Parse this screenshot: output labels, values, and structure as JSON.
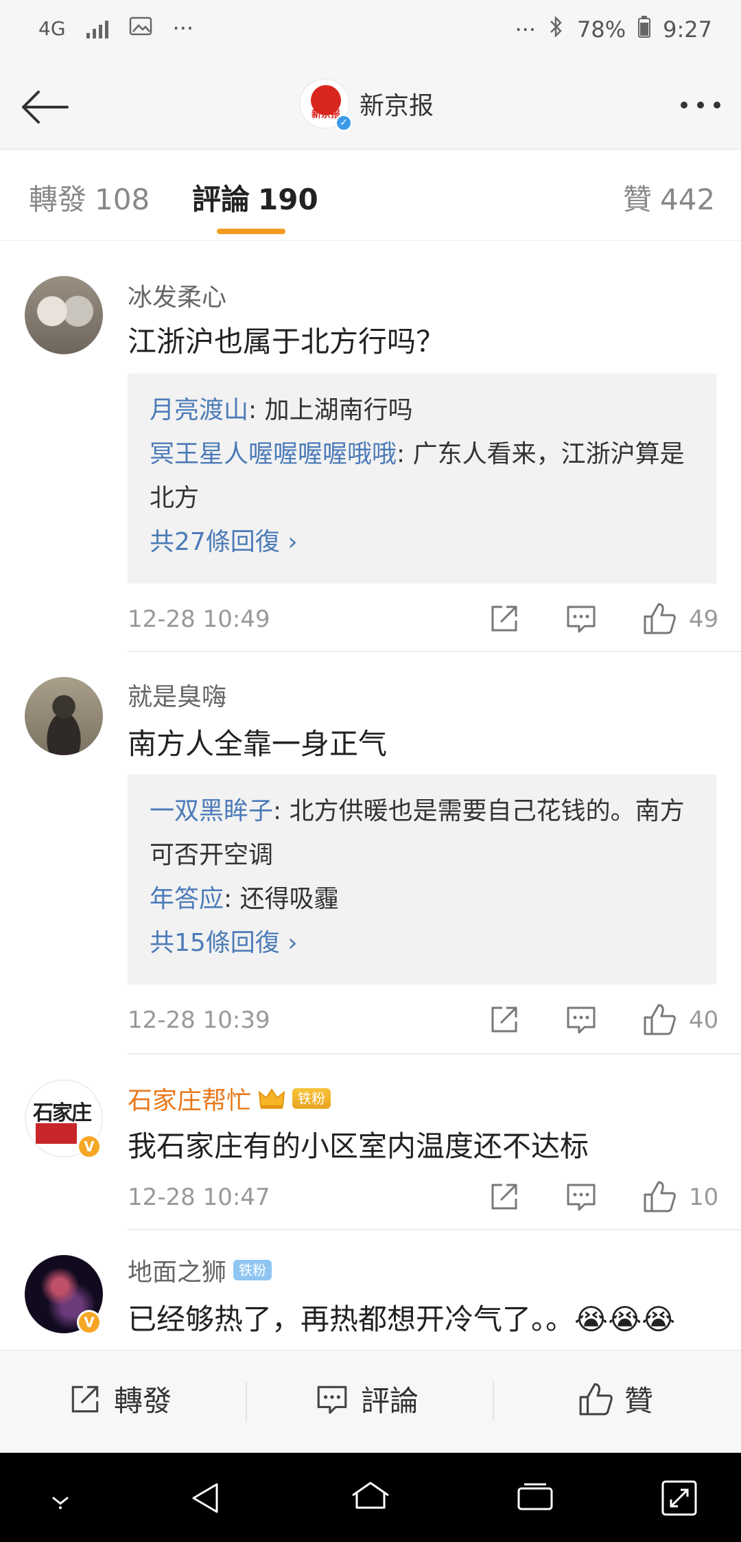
{
  "status_bar": {
    "network": "4G",
    "dots_left": "···",
    "dots_right": "···",
    "battery": "78%",
    "time": "9:27"
  },
  "header": {
    "logo_text": "新京报",
    "account_name": "新京报"
  },
  "tabs": [
    {
      "label": "轉發",
      "count": "108"
    },
    {
      "label": "評論",
      "count": "190",
      "active": true
    },
    {
      "label": "贊",
      "count": "442"
    }
  ],
  "comments": [
    {
      "user": "冰发柔心",
      "text": "江浙沪也属于北方行吗？",
      "replies": [
        {
          "name": "月亮渡山",
          "text": ": 加上湖南行吗"
        },
        {
          "name": "冥王星人喔喔喔喔哦哦",
          "text": ": 广东人看来，江浙沪算是北方"
        }
      ],
      "more_replies": "共27條回復 ›",
      "time": "12-28 10:49",
      "likes": "49"
    },
    {
      "user": "就是臭嗨",
      "text": "南方人全靠一身正气",
      "replies": [
        {
          "name": "一双黑眸子",
          "text": ": 北方供暖也是需要自己花钱的。南方可否开空调"
        },
        {
          "name": "年答应",
          "text": ": 还得吸霾"
        }
      ],
      "more_replies": "共15條回復 ›",
      "time": "12-28 10:39",
      "likes": "40"
    },
    {
      "user": "石家庄帮忙",
      "badge": "铁粉",
      "avatar_text": "石家庄",
      "text": "我石家庄有的小区室内温度还不达标",
      "time": "12-28 10:47",
      "likes": "10"
    },
    {
      "user": "地面之狮",
      "badge": "铁粉",
      "text": "已经够热了，再热都想开冷气了。。😭😭😭"
    }
  ],
  "bottom_bar": {
    "repost": "轉發",
    "comment": "評論",
    "like": "贊"
  },
  "colors": {
    "accent": "#f29a21",
    "link": "#4c7bb8",
    "vip_name": "#e8781a"
  }
}
